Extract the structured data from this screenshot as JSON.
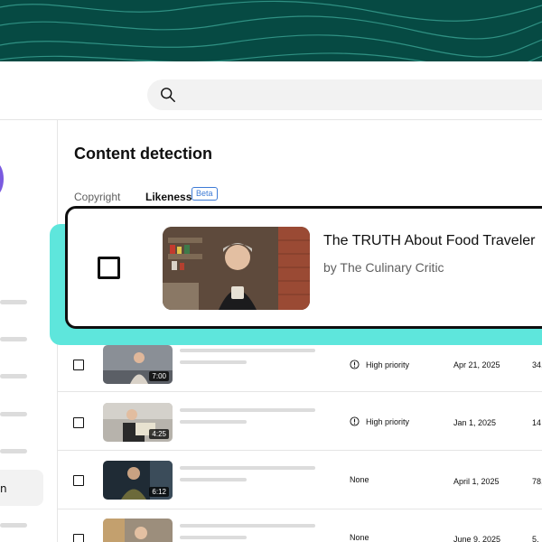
{
  "search": {
    "placeholder": ""
  },
  "content": {
    "title": "Content detection",
    "tabs": [
      {
        "label": "Copyright"
      },
      {
        "label": "Likeness",
        "badge": "Beta"
      }
    ]
  },
  "sidebar": {
    "active_item_label": "n"
  },
  "featured": {
    "title": "The TRUTH About Food Traveler",
    "channel": "by The Culinary Critic"
  },
  "rows": [
    {
      "duration": "7:00",
      "priority": "High priority",
      "priority_icon": "alert-circle-icon",
      "date": "Apr 21, 2025",
      "count": "34,"
    },
    {
      "duration": "4:25",
      "priority": "High priority",
      "priority_icon": "alert-circle-icon",
      "date": "Jan 1, 2025",
      "count": "14"
    },
    {
      "duration": "6:12",
      "priority": "None",
      "date": "April 1, 2025",
      "count": "78,"
    },
    {
      "duration": "",
      "priority": "None",
      "date": "June 9, 2025",
      "count": "5,"
    }
  ],
  "colors": {
    "band": "#064a43",
    "highlight": "#5ee6dc",
    "beta": "#3e7bd6",
    "avatar": "#7a5ae0"
  }
}
